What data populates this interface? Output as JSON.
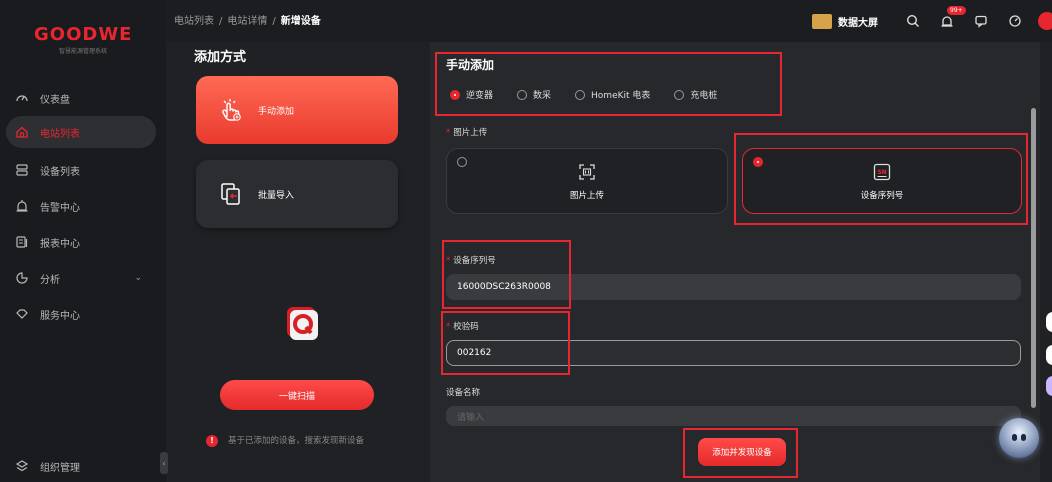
{
  "app": {
    "brand": "GOODWE",
    "brand_sub": "智慧能源管理系统",
    "accent": "#e8262f"
  },
  "sidebar": {
    "items": [
      {
        "label": "仪表盘",
        "icon": "dashboard-icon"
      },
      {
        "label": "电站列表",
        "icon": "home-icon",
        "active": true
      },
      {
        "label": "设备列表",
        "icon": "device-list-icon"
      },
      {
        "label": "告警中心",
        "icon": "bell-icon"
      },
      {
        "label": "报表中心",
        "icon": "report-icon"
      },
      {
        "label": "分析",
        "icon": "pie-chart-icon"
      },
      {
        "label": "服务中心",
        "icon": "service-icon"
      }
    ],
    "footer": {
      "label": "组织管理",
      "icon": "organization-icon"
    }
  },
  "topbar": {
    "breadcrumbs": [
      "电站列表",
      "电站详情",
      "新增设备"
    ],
    "screen_label": "数据大屏",
    "notification_badge": "99+"
  },
  "add_panel": {
    "title": "添加方式",
    "methods": [
      {
        "label": "手动添加",
        "icon": "hand-pointer-icon",
        "active": true
      },
      {
        "label": "批量导入",
        "icon": "import-icon"
      }
    ],
    "scan_button": "一键扫描",
    "hint": "基于已添加的设备，搜索发现新设备"
  },
  "form": {
    "title": "手动添加",
    "device_types": [
      {
        "label": "逆变器",
        "selected": true
      },
      {
        "label": "数采",
        "selected": false
      },
      {
        "label": "HomeKit 电表",
        "selected": false
      },
      {
        "label": "充电桩",
        "selected": false
      }
    ],
    "upload_label": "图片上传",
    "upload_options": [
      {
        "label": "图片上传",
        "selected": false,
        "icon": "image-scan-icon"
      },
      {
        "label": "设备序列号",
        "selected": true,
        "icon": "sn-icon"
      }
    ],
    "serial_label": "设备序列号",
    "serial_value": "16000DSC263R0008",
    "check_label": "校验码",
    "check_value": "002162",
    "name_label": "设备名称",
    "name_placeholder": "请输入",
    "submit_label": "添加并发现设备"
  }
}
